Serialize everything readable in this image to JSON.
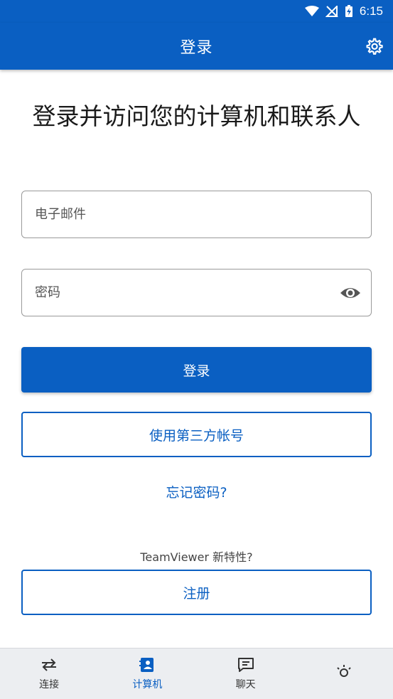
{
  "status_bar": {
    "time": "6:15"
  },
  "app_bar": {
    "title": "登录"
  },
  "headline": "登录并访问您的计算机和联系人",
  "email": {
    "placeholder": "电子邮件",
    "value": ""
  },
  "password": {
    "placeholder": "密码",
    "value": ""
  },
  "login_button": "登录",
  "third_party_button": "使用第三方帐号",
  "forgot_password": "忘记密码?",
  "whats_new": "TeamViewer 新特性?",
  "register_button": "注册",
  "bottom_nav": {
    "items": [
      {
        "label": "连接",
        "icon": "connect-arrows-icon"
      },
      {
        "label": "计算机",
        "icon": "contacts-book-icon",
        "active": true
      },
      {
        "label": "聊天",
        "icon": "chat-icon"
      },
      {
        "label": "",
        "icon": "solution-icon"
      }
    ]
  },
  "colors": {
    "brand": "#0a5fc2",
    "nav_bg": "#eceef1"
  }
}
